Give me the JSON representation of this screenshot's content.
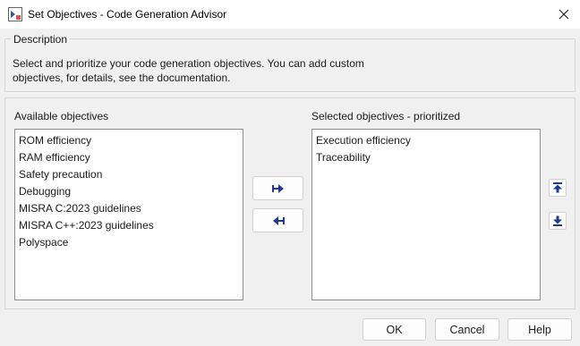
{
  "window": {
    "title": "Set Objectives - Code Generation Advisor"
  },
  "description": {
    "legend": "Description",
    "lines": [
      "Select and prioritize your code generation objectives. You can add custom",
      "objectives, for details, see the documentation."
    ]
  },
  "available": {
    "label": "Available objectives",
    "items": [
      "ROM efficiency",
      "RAM efficiency",
      "Safety precaution",
      "Debugging",
      "MISRA C:2023 guidelines",
      "MISRA C++:2023 guidelines",
      "Polyspace"
    ]
  },
  "selected": {
    "label": "Selected objectives - prioritized",
    "items": [
      "Execution efficiency",
      "Traceability"
    ]
  },
  "buttons": {
    "ok": "OK",
    "cancel": "Cancel",
    "help": "Help"
  },
  "icons": {
    "app": "simulink-app-icon",
    "close": "close-icon",
    "add": "add-to-selected-icon",
    "remove": "remove-from-selected-icon",
    "up": "move-up-icon",
    "down": "move-down-icon"
  },
  "colors": {
    "arrow": "#1f3a93",
    "border": "#8c8c8c",
    "group_border": "#d4d4d4"
  }
}
